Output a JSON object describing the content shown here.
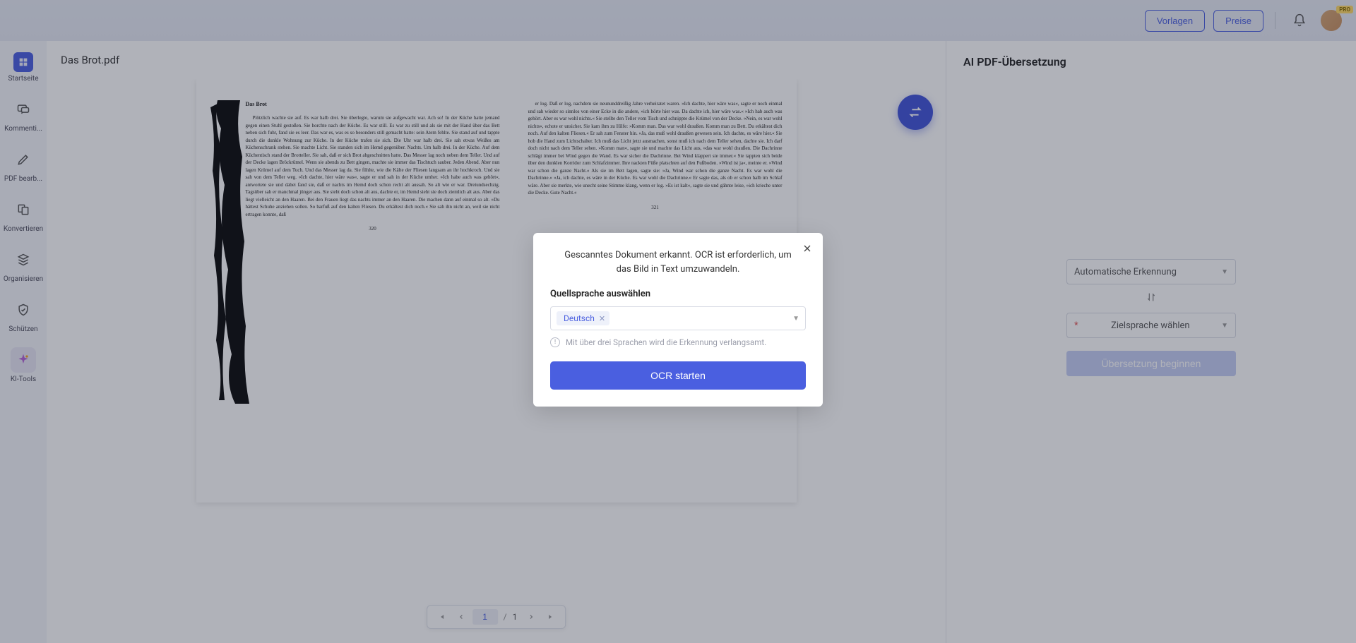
{
  "topbar": {
    "templates": "Vorlagen",
    "pricing": "Preise",
    "pro_badge": "PRO"
  },
  "sidebar": {
    "items": [
      {
        "label": "Startseite"
      },
      {
        "label": "Kommenti..."
      },
      {
        "label": "PDF bearb..."
      },
      {
        "label": "Konvertieren"
      },
      {
        "label": "Organisieren"
      },
      {
        "label": "Schützen"
      },
      {
        "label": "KI-Tools"
      }
    ]
  },
  "document": {
    "filename": "Das Brot.pdf",
    "page_left": {
      "heading": "Das Brot",
      "body": "Plötzlich wachte sie auf. Es war halb drei. Sie überlegte, warum sie aufgewacht war. Ach so! In der Küche hatte jemand gegen einen Stuhl gestoßen. Sie horchte nach der Küche. Es war still. Es war zu still und als sie mit der Hand über das Bett neben sich fuhr, fand sie es leer. Das war es, was es so besonders still gemacht hatte: sein Atem fehlte. Sie stand auf und tappte durch die dunkle Wohnung zur Küche. In der Küche trafen sie sich. Die Uhr war halb drei. Sie sah etwas Weißes am Küchenschrank stehen. Sie machte Licht. Sie standen sich im Hemd gegenüber. Nachts. Um halb drei. In der Küche. Auf dem Küchentisch stand der Brotteller. Sie sah, daß er sich Brot abgeschnitten hatte. Das Messer lag noch neben dem Teller. Und auf der Decke lagen Bröckrümel. Wenn sie abends zu Bett gingen, machte sie immer das Tischtuch sauber. Jeden Abend. Aber nun lagen Krümel auf dem Tuch. Und das Messer lag da. Sie fühlte, wie die Kälte der Fliesen langsam an ihr hochkroch. Und sie sah von dem Teller weg. »Ich dachte, hier wäre was«, sagte er und sah in der Küche umher. »Ich habe auch was gehört«, antwortete sie und dabei fand sie, daß er nachts im Hemd doch schon recht alt aussah. So alt wie er war. Dreiundsechzig. Tagsüber sah er manchmal jünger aus. Sie sieht doch schon alt aus, dachte er, im Hemd sieht sie doch ziemlich alt aus. Aber das liegt vielleicht an den Haaren. Bei den Frauen liegt das nachts immer an den Haaren. Die machen dann auf einmal so alt. »Du hättest Schuhe anziehen sollen. So barfuß auf den kalten Fliesen. Du erkältest dich noch.« Sie sah ihn nicht an, weil sie nicht ertragen konnte, daß",
      "page_num": "320"
    },
    "page_right": {
      "body": "er log. Daß er log, nachdem sie neununddreißig Jahre verheiratet waren. »Ich dachte, hier wäre was«, sagte er noch einmal und sah wieder so sinnlos von einer Ecke in die andere, »ich hörte hier was. Da dachte ich, hier wäre was.« »Ich hab auch was gehört. Aber es war wohl nichts.« Sie stellte den Teller vom Tisch und schnippte die Krümel von der Decke. »Nein, es war wohl nichts«, echote er unsicher. Sie kam ihm zu Hilfe: »Komm man. Das war wohl draußen. Komm man zu Bett. Du erkältest dich noch. Auf den kalten Fliesen.« Er sah zum Fenster hin. »Ja, das muß wohl draußen gewesen sein. Ich dachte, es wäre hier.« Sie hob die Hand zum Lichtschalter. Ich muß das Licht jetzt ausmachen, sonst muß ich nach dem Teller sehen, dachte sie. Ich darf doch nicht nach dem Teller sehen. »Komm man«, sagte sie und machte das Licht aus, »das war wohl draußen. Die Dachrinne schlägt immer bei Wind gegen die Wand. Es war sicher die Dachrinne. Bei Wind klappert sie immer.« Sie tappten sich beide über den dunklen Korridor zum Schlafzimmer. Ihre nackten Füße platschten auf den Fußboden. »Wind ist ja«, meinte er. »Wind war schon die ganze Nacht.« Als sie im Bett lagen, sagte sie: »Ja, Wind war schon die ganze Nacht. Es war wohl die Dachrinne.« »Ja, ich dachte, es wäre in der Küche. Es war wohl die Dachrinne.« Er sagte das, als ob er schon halb im Schlaf wäre. Aber sie merkte, wie unecht seine Stimme klang, wenn er log. »Es ist kalt«, sagte sie und gähnte leise, »ich krieche unter die Decke. Gute Nacht.«",
      "page_num": "321"
    }
  },
  "pager": {
    "current": "1",
    "separator": "/",
    "total": "1"
  },
  "translate_panel": {
    "title": "AI PDF-Übersetzung",
    "source_lang": "Automatische Erkennung",
    "target_placeholder": "Zielsprache wählen",
    "start_button": "Übersetzung beginnen"
  },
  "modal": {
    "message": "Gescanntes Dokument erkannt. OCR ist erforderlich, um das Bild in Text umzuwandeln.",
    "label": "Quellsprache auswählen",
    "chip": "Deutsch",
    "hint": "Mit über drei Sprachen wird die Erkennung verlangsamt.",
    "button": "OCR starten"
  }
}
